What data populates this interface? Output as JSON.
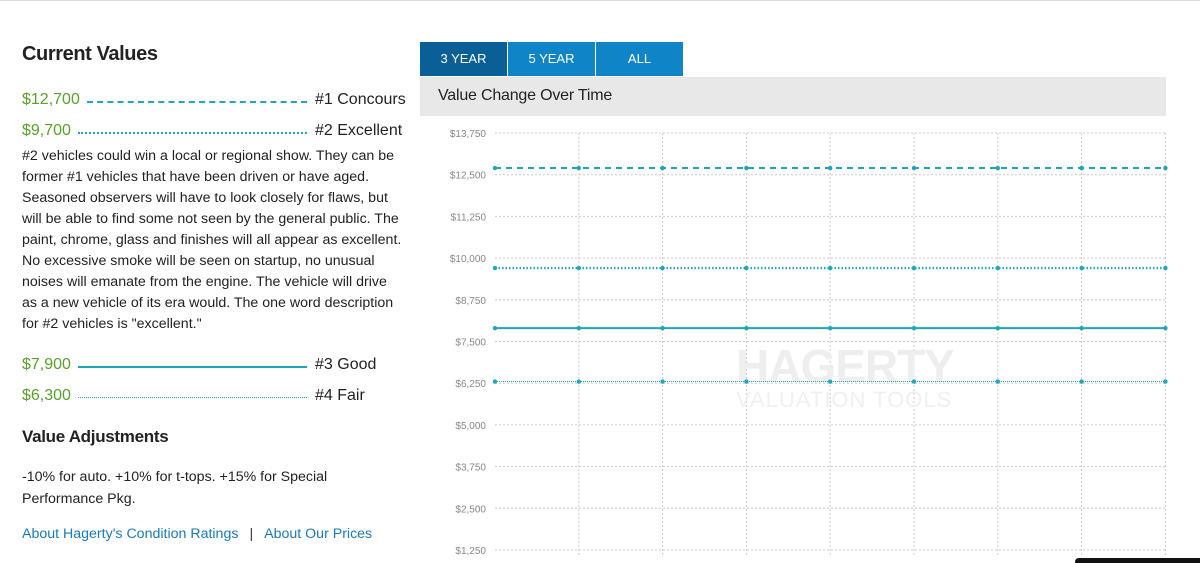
{
  "current_values": {
    "title": "Current Values",
    "rows": [
      {
        "price": "$12,700",
        "label": "#1 Concours",
        "line": "dash"
      },
      {
        "price": "$9,700",
        "label": "#2 Excellent",
        "line": "dot"
      },
      {
        "price": "$7,900",
        "label": "#3 Good",
        "line": "solid"
      },
      {
        "price": "$6,300",
        "label": "#4 Fair",
        "line": "thin"
      }
    ],
    "description": "#2 vehicles could win a local or regional show. They can be former #1 vehicles that have been driven or have aged. Seasoned observers will have to look closely for flaws, but will be able to find some not seen by the general public. The paint, chrome, glass and finishes will all appear as excellent. No excessive smoke will be seen on startup, no unusual noises will emanate from the engine. The vehicle will drive as a new vehicle of its era would. The one word description for #2 vehicles is \"excellent.\""
  },
  "value_adjustments": {
    "title": "Value Adjustments",
    "text": "-10% for auto. +10% for t-tops. +15% for Special Performance Pkg."
  },
  "links": {
    "condition_ratings": "About Hagerty's Condition Ratings",
    "separator": "|",
    "our_prices": "About Our Prices"
  },
  "tabs": [
    {
      "label": "3 YEAR",
      "active": true
    },
    {
      "label": "5 YEAR",
      "active": false
    },
    {
      "label": "ALL",
      "active": false
    }
  ],
  "chart_header": "Value Change Over Time",
  "watermark": {
    "brand": "HAGERTY",
    "sub": "VALUATION TOOLS"
  },
  "colors": {
    "price_green": "#5aa02c",
    "series_teal": "#1fa6b8",
    "tab_blue": "#0f84c6",
    "tab_active": "#0a5f96",
    "link_blue": "#1a7ab8"
  },
  "chart_data": {
    "type": "line",
    "title": "Value Change Over Time",
    "ylim": [
      1250,
      13750
    ],
    "y_ticks": [
      "$13,750",
      "$12,500",
      "$11,250",
      "$10,000",
      "$8,750",
      "$7,500",
      "$6,250",
      "$5,000",
      "$3,750",
      "$2,500",
      "$1,250"
    ],
    "y_tick_values": [
      13750,
      12500,
      11250,
      10000,
      8750,
      7500,
      6250,
      5000,
      3750,
      2500,
      1250
    ],
    "grid": true,
    "series": [
      {
        "name": "#1 Concours",
        "style": "dash",
        "values": [
          12700,
          12700,
          12700,
          12700,
          12700,
          12700,
          12700,
          12700,
          12700,
          12700
        ]
      },
      {
        "name": "#2 Excellent",
        "style": "dot",
        "values": [
          9700,
          9700,
          9700,
          9700,
          9700,
          9700,
          9700,
          9700,
          9700,
          9700
        ]
      },
      {
        "name": "#3 Good",
        "style": "solid",
        "values": [
          7900,
          7900,
          7900,
          7900,
          7900,
          7900,
          7900,
          7900,
          7900,
          7900
        ]
      },
      {
        "name": "#4 Fair",
        "style": "thin",
        "values": [
          6300,
          6300,
          6300,
          6300,
          6300,
          6300,
          6300,
          6300,
          6300,
          6300
        ]
      }
    ]
  }
}
